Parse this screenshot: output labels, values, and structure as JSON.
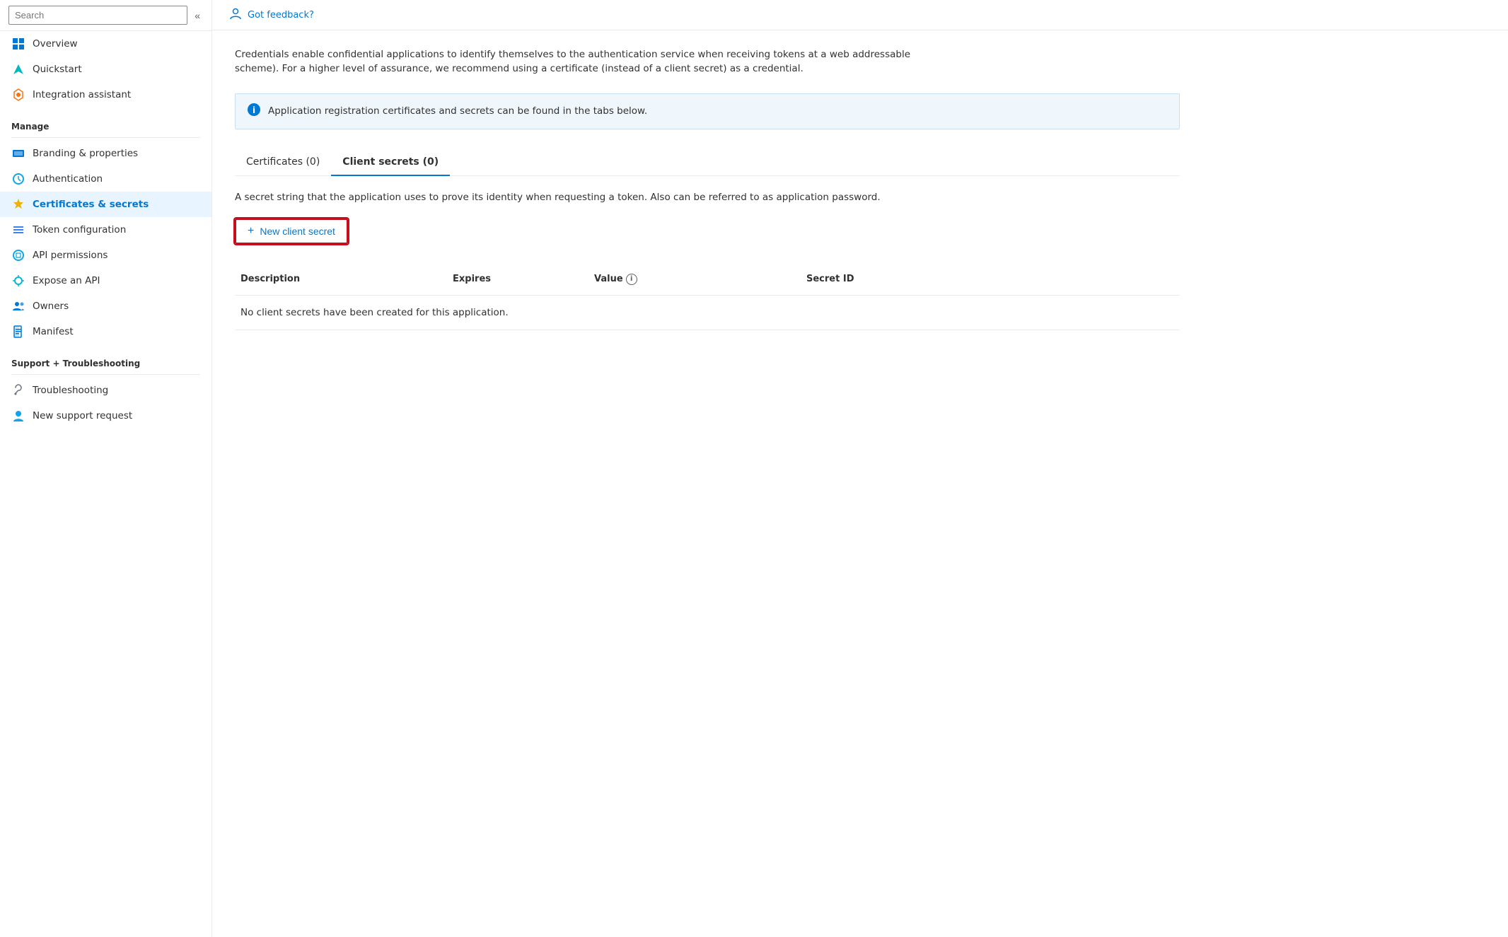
{
  "sidebar": {
    "search_placeholder": "Search",
    "nav_items": [
      {
        "id": "overview",
        "label": "Overview",
        "icon": "⊞",
        "active": false
      },
      {
        "id": "quickstart",
        "label": "Quickstart",
        "icon": "🚀",
        "active": false
      },
      {
        "id": "integration-assistant",
        "label": "Integration assistant",
        "icon": "🚀",
        "active": false
      }
    ],
    "manage_section": "Manage",
    "manage_items": [
      {
        "id": "branding",
        "label": "Branding & properties",
        "icon": "🏷",
        "active": false
      },
      {
        "id": "authentication",
        "label": "Authentication",
        "icon": "◎",
        "active": false
      },
      {
        "id": "certificates",
        "label": "Certificates & secrets",
        "icon": "🔑",
        "active": true
      },
      {
        "id": "token",
        "label": "Token configuration",
        "icon": "≡",
        "active": false
      },
      {
        "id": "api-permissions",
        "label": "API permissions",
        "icon": "◎",
        "active": false
      },
      {
        "id": "expose-api",
        "label": "Expose an API",
        "icon": "☁",
        "active": false
      },
      {
        "id": "owners",
        "label": "Owners",
        "icon": "👥",
        "active": false
      },
      {
        "id": "manifest",
        "label": "Manifest",
        "icon": "📄",
        "active": false
      }
    ],
    "support_section": "Support + Troubleshooting",
    "support_items": [
      {
        "id": "troubleshooting",
        "label": "Troubleshooting",
        "icon": "🔧",
        "active": false
      },
      {
        "id": "support-request",
        "label": "New support request",
        "icon": "👤",
        "active": false
      }
    ]
  },
  "topbar": {
    "feedback_text": "Got feedback?",
    "icon": "👥"
  },
  "main": {
    "description": "Credentials enable confidential applications to identify themselves to the authentication service when receiving tokens at a web addressable scheme). For a higher level of assurance, we recommend using a certificate (instead of a client secret) as a credential.",
    "info_banner": "Application registration certificates and secrets can be found in the tabs below.",
    "tabs": [
      {
        "id": "certificates",
        "label": "Certificates (0)",
        "active": false
      },
      {
        "id": "client-secrets",
        "label": "Client secrets (0)",
        "active": true
      }
    ],
    "section_description": "A secret string that the application uses to prove its identity when requesting a token. Also can be referred to as application password.",
    "new_secret_button": "New client secret",
    "table_headers": {
      "description": "Description",
      "expires": "Expires",
      "value": "Value",
      "value_info": "ℹ",
      "secret_id": "Secret ID"
    },
    "empty_message": "No client secrets have been created for this application."
  }
}
